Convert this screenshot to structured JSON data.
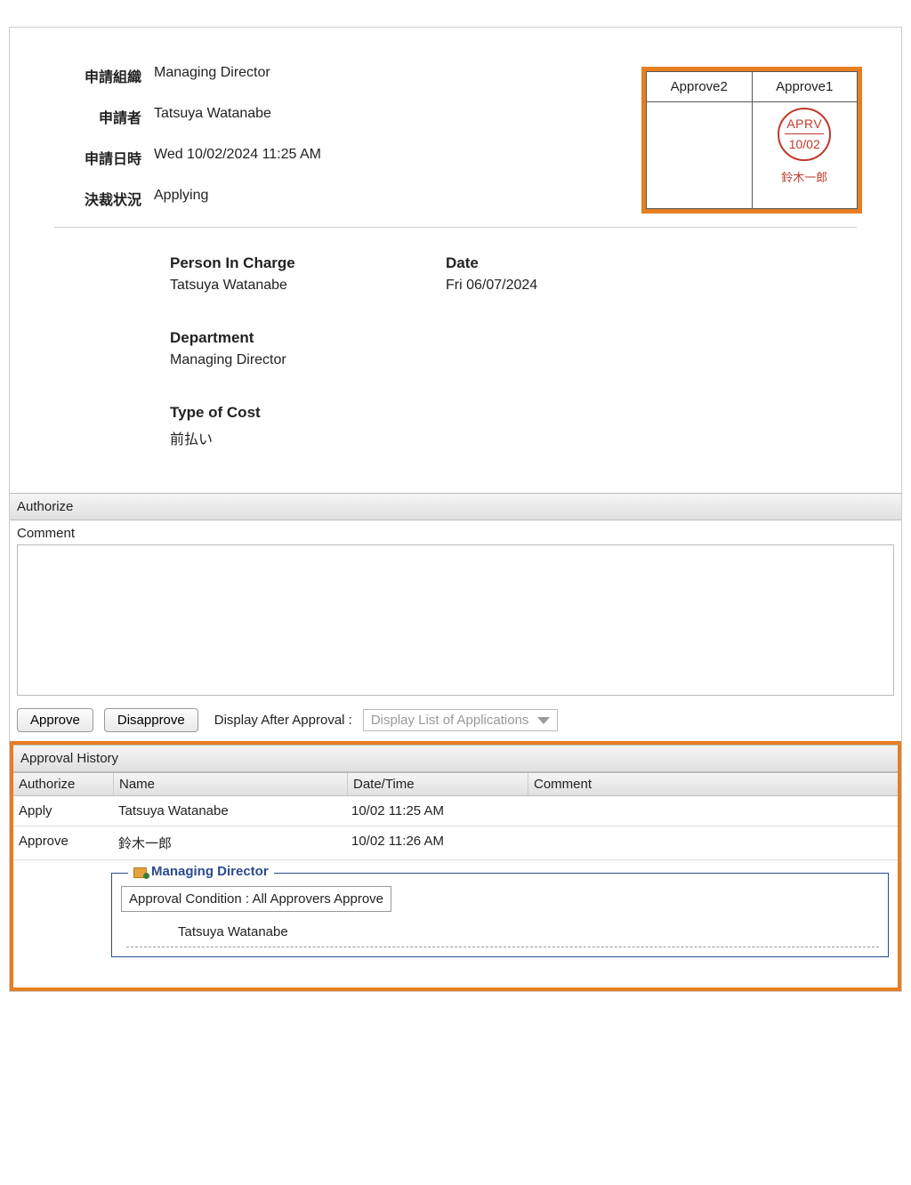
{
  "meta": {
    "orgLabel": "申請組織",
    "orgValue": "Managing Director",
    "applicantLabel": "申請者",
    "applicantValue": "Tatsuya Watanabe",
    "dateLabel": "申請日時",
    "dateValue": "Wed 10/02/2024 11:25 AM",
    "statusLabel": "決裁状況",
    "statusValue": "Applying"
  },
  "stamps": {
    "col1": {
      "header": "Approve2",
      "aprv": "",
      "date": "",
      "name": ""
    },
    "col2": {
      "header": "Approve1",
      "aprv": "APRV",
      "date": "10/02",
      "name": "鈴木一郎"
    }
  },
  "details": {
    "personLabel": "Person In Charge",
    "personValue": "Tatsuya Watanabe",
    "dateLabel": "Date",
    "dateValue": "Fri 06/07/2024",
    "deptLabel": "Department",
    "deptValue": "Managing Director",
    "costLabel": "Type of Cost",
    "costValue": "前払い"
  },
  "authorize": {
    "sectionTitle": "Authorize",
    "commentLabel": "Comment",
    "approveBtn": "Approve",
    "disapproveBtn": "Disapprove",
    "afterLabel": "Display After Approval :",
    "afterValue": "Display List of Applications"
  },
  "history": {
    "title": "Approval History",
    "headers": {
      "auth": "Authorize",
      "name": "Name",
      "date": "Date/Time",
      "comment": "Comment"
    },
    "rows": [
      {
        "auth": "Apply",
        "name": "Tatsuya Watanabe",
        "date": "10/02 11:25 AM",
        "comment": ""
      },
      {
        "auth": "Approve",
        "name": "鈴木一郎",
        "date": "10/02 11:26 AM",
        "comment": ""
      }
    ],
    "flow": {
      "legend": "Managing Director",
      "conditionLabel": "Approval Condition :",
      "conditionValue": "All Approvers Approve",
      "member": "Tatsuya Watanabe"
    }
  }
}
